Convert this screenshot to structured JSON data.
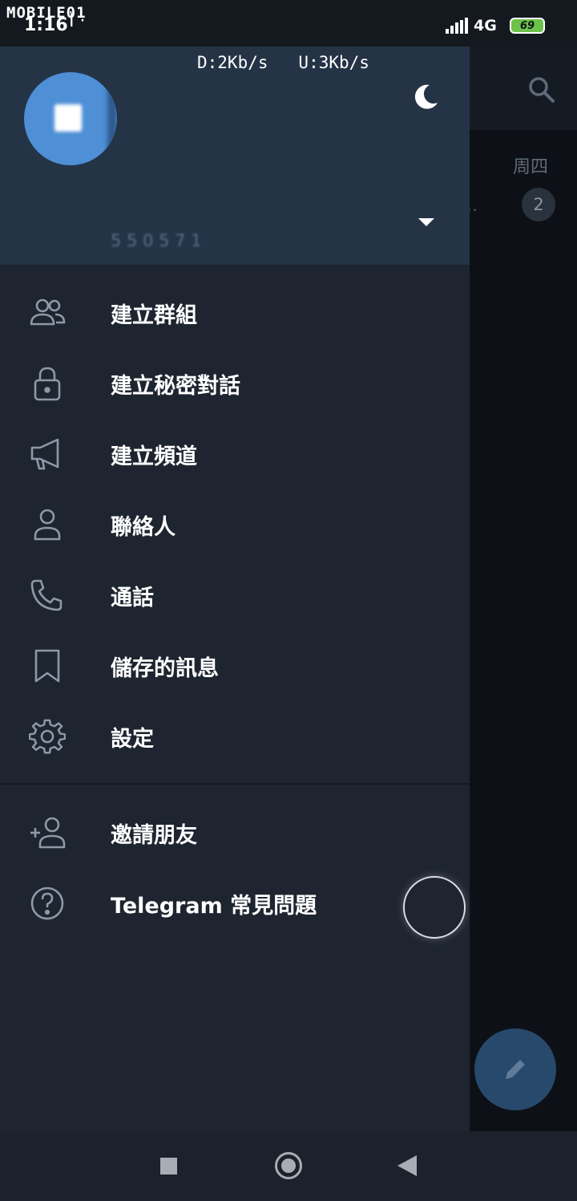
{
  "status_bar": {
    "watermark": "MOBILE01",
    "time": "1:16",
    "extra": "I ·",
    "network": "4G",
    "battery": "69"
  },
  "background": {
    "day_label": "周四",
    "preview_dots": "..",
    "unread_count": "2",
    "search_icon": "search-icon",
    "fab_icon": "pencil-icon"
  },
  "drawer": {
    "speed": "D:2Kb/s   U:3Kb/s",
    "phone_hint": "5 5 0 5 7 1",
    "night_mode_icon": "moon-icon",
    "menu": [
      {
        "label": "建立群組",
        "icon": "group-icon"
      },
      {
        "label": "建立秘密對話",
        "icon": "lock-icon"
      },
      {
        "label": "建立頻道",
        "icon": "megaphone-icon"
      },
      {
        "label": "聯絡人",
        "icon": "contact-icon"
      },
      {
        "label": "通話",
        "icon": "phone-icon"
      },
      {
        "label": "儲存的訊息",
        "icon": "bookmark-icon"
      },
      {
        "label": "設定",
        "icon": "gear-icon"
      }
    ],
    "menu_secondary": [
      {
        "label": "邀請朋友",
        "icon": "add-user-icon"
      },
      {
        "label": "Telegram 常見問題",
        "icon": "help-icon"
      }
    ]
  },
  "colors": {
    "drawer_bg": "#1e2530",
    "header_bg": "#243346",
    "avatar": "#4e8fd6",
    "icon": "#8e99a6"
  }
}
